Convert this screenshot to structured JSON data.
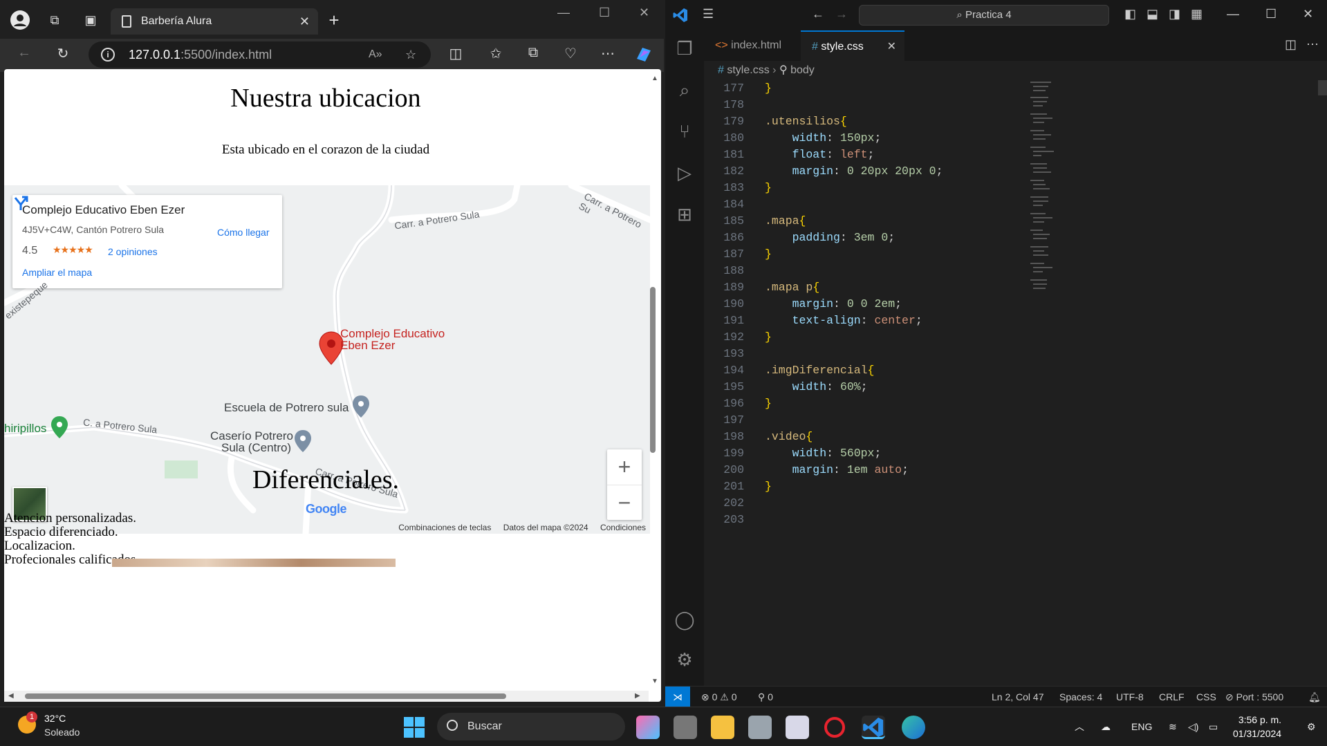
{
  "browser": {
    "tab_title": "Barbería Alura",
    "url_host": "127.0.0.1",
    "url_path": ":5500/index.html",
    "page": {
      "title": "Nuestra ubicacion",
      "subtitle": "Esta ubicado en el corazon de la ciudad",
      "section2_title": "Diferenciales.",
      "diferenciales": [
        "Atencion personalizadas.",
        "Espacio diferenciado.",
        "Localizacion.",
        "Profecionales calificados."
      ]
    },
    "map": {
      "place_name": "Complejo Educativo Eben Ezer",
      "address": "4J5V+C4W, Cantón Potrero Sula",
      "rating": "4.5",
      "stars": "★★★★★",
      "reviews": "2 opiniones",
      "directions": "Cómo llegar",
      "enlarge": "Ampliar el mapa",
      "pin_label_1": "Complejo Educativo",
      "pin_label_2": "Eben Ezer",
      "poi_school": "Escuela de Potrero sula",
      "poi_caserio_1": "Caserío Potrero",
      "poi_caserio_2": "Sula (Centro)",
      "poi_left": "hiripillos",
      "road_1": "Carr. a Potrero Sula",
      "road_2": "Carr. a Potrero Su",
      "road_3": "C. a Potrero Sula",
      "road_4": "Carr. a Potrero Sula",
      "road_5": "existepeque",
      "zoom_in": "+",
      "zoom_out": "−",
      "google": "Google",
      "footer": [
        "Combinaciones de teclas",
        "Datos del mapa ©2024",
        "Condiciones"
      ]
    }
  },
  "vscode": {
    "search": "Practica 4",
    "tabs": [
      {
        "label": "index.html",
        "icon": "html-icon"
      },
      {
        "label": "style.css",
        "icon": "css-icon"
      }
    ],
    "breadcrumb": [
      "style.css",
      "body"
    ],
    "lines": [
      {
        "n": "177",
        "tokens": [
          {
            "t": "}",
            "c": "c-br"
          }
        ]
      },
      {
        "n": "178",
        "tokens": []
      },
      {
        "n": "179",
        "tokens": [
          {
            "t": ".utensilios",
            "c": "c-sel"
          },
          {
            "t": "{",
            "c": "c-br"
          }
        ]
      },
      {
        "n": "180",
        "tokens": [
          {
            "t": "    width",
            "c": "c-prop"
          },
          {
            "t": ": ",
            "c": ""
          },
          {
            "t": "150px",
            "c": "c-num"
          },
          {
            "t": ";",
            "c": ""
          }
        ]
      },
      {
        "n": "181",
        "tokens": [
          {
            "t": "    float",
            "c": "c-prop"
          },
          {
            "t": ": ",
            "c": ""
          },
          {
            "t": "left",
            "c": "c-val"
          },
          {
            "t": ";",
            "c": ""
          }
        ]
      },
      {
        "n": "182",
        "tokens": [
          {
            "t": "    margin",
            "c": "c-prop"
          },
          {
            "t": ": ",
            "c": ""
          },
          {
            "t": "0 20px 20px 0",
            "c": "c-num"
          },
          {
            "t": ";",
            "c": ""
          }
        ]
      },
      {
        "n": "183",
        "tokens": [
          {
            "t": "}",
            "c": "c-br"
          }
        ]
      },
      {
        "n": "184",
        "tokens": []
      },
      {
        "n": "185",
        "tokens": [
          {
            "t": ".mapa",
            "c": "c-sel"
          },
          {
            "t": "{",
            "c": "c-br"
          }
        ]
      },
      {
        "n": "186",
        "tokens": [
          {
            "t": "    padding",
            "c": "c-prop"
          },
          {
            "t": ": ",
            "c": ""
          },
          {
            "t": "3em 0",
            "c": "c-num"
          },
          {
            "t": ";",
            "c": ""
          }
        ]
      },
      {
        "n": "187",
        "tokens": [
          {
            "t": "}",
            "c": "c-br"
          }
        ]
      },
      {
        "n": "188",
        "tokens": []
      },
      {
        "n": "189",
        "tokens": [
          {
            "t": ".mapa p",
            "c": "c-sel"
          },
          {
            "t": "{",
            "c": "c-br"
          }
        ]
      },
      {
        "n": "190",
        "tokens": [
          {
            "t": "    margin",
            "c": "c-prop"
          },
          {
            "t": ": ",
            "c": ""
          },
          {
            "t": "0 0 2em",
            "c": "c-num"
          },
          {
            "t": ";",
            "c": ""
          }
        ]
      },
      {
        "n": "191",
        "tokens": [
          {
            "t": "    text-align",
            "c": "c-prop"
          },
          {
            "t": ": ",
            "c": ""
          },
          {
            "t": "center",
            "c": "c-val"
          },
          {
            "t": ";",
            "c": ""
          }
        ]
      },
      {
        "n": "192",
        "tokens": [
          {
            "t": "}",
            "c": "c-br"
          }
        ]
      },
      {
        "n": "193",
        "tokens": []
      },
      {
        "n": "194",
        "tokens": [
          {
            "t": ".imgDiferencial",
            "c": "c-sel"
          },
          {
            "t": "{",
            "c": "c-br"
          }
        ]
      },
      {
        "n": "195",
        "tokens": [
          {
            "t": "    width",
            "c": "c-prop"
          },
          {
            "t": ": ",
            "c": ""
          },
          {
            "t": "60%",
            "c": "c-num"
          },
          {
            "t": ";",
            "c": ""
          }
        ]
      },
      {
        "n": "196",
        "tokens": [
          {
            "t": "}",
            "c": "c-br"
          }
        ]
      },
      {
        "n": "197",
        "tokens": []
      },
      {
        "n": "198",
        "tokens": [
          {
            "t": ".video",
            "c": "c-sel"
          },
          {
            "t": "{",
            "c": "c-br"
          }
        ]
      },
      {
        "n": "199",
        "tokens": [
          {
            "t": "    width",
            "c": "c-prop"
          },
          {
            "t": ": ",
            "c": ""
          },
          {
            "t": "560px",
            "c": "c-num"
          },
          {
            "t": ";",
            "c": ""
          }
        ]
      },
      {
        "n": "200",
        "tokens": [
          {
            "t": "    margin",
            "c": "c-prop"
          },
          {
            "t": ": ",
            "c": ""
          },
          {
            "t": "1em ",
            "c": "c-num"
          },
          {
            "t": "auto",
            "c": "c-val"
          },
          {
            "t": ";",
            "c": ""
          }
        ]
      },
      {
        "n": "201",
        "tokens": [
          {
            "t": "}",
            "c": "c-br"
          }
        ]
      },
      {
        "n": "202",
        "tokens": []
      },
      {
        "n": "203",
        "tokens": []
      }
    ],
    "status": {
      "errors": "0",
      "warnings": "0",
      "ports": "0",
      "position": "Ln 2, Col 47",
      "spaces": "Spaces: 4",
      "encoding": "UTF-8",
      "eol": "CRLF",
      "language": "CSS",
      "port": "Port : 5500"
    }
  },
  "taskbar": {
    "temp": "32°C",
    "condition": "Soleado",
    "weather_badge": "1",
    "search": "Buscar",
    "lang": "ENG",
    "time": "3:56 p. m.",
    "date": "01/31/2024"
  }
}
